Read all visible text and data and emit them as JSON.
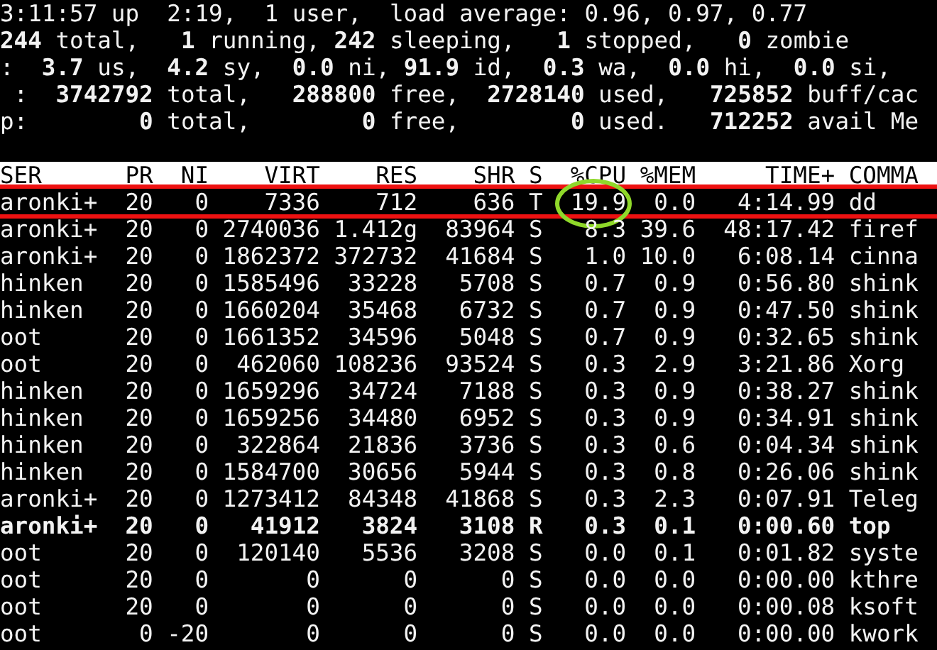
{
  "summary": [
    "3:11:57 up  2:19,  1 user,  load average: 0.96, 0.97, 0.77",
    "**244** total,   **1** running, **242** sleeping,   **1** stopped,   **0** zombie",
    ":  **3.7** us,  **4.2** sy,  **0.0** ni, **91.9** id,  **0.3** wa,  **0.0** hi,  **0.0** si,",
    " :  **3742792** total,   **288800** free,  **2728140** used,   **725852** buff/cac",
    "p:        **0** total,        **0** free,        **0** used.   **712252** avail Me"
  ],
  "columns": [
    "SER",
    "PR",
    "NI",
    "VIRT",
    "RES",
    "SHR",
    "S",
    "%CPU",
    "%MEM",
    "TIME+",
    "COMMA"
  ],
  "processes": [
    {
      "cells": [
        "aronki+",
        "20",
        "0",
        "7336",
        "712",
        "636",
        "T",
        "19.9",
        "0.0",
        "4:14.99",
        "dd"
      ],
      "bold": false,
      "highlighted": true,
      "circled": true
    },
    {
      "cells": [
        "aronki+",
        "20",
        "0",
        "2740036",
        "1.412g",
        "83964",
        "S",
        "8.3",
        "39.6",
        "48:17.42",
        "firef"
      ],
      "bold": false,
      "highlighted": false,
      "circled": false
    },
    {
      "cells": [
        "aronki+",
        "20",
        "0",
        "1862372",
        "372732",
        "41684",
        "S",
        "1.0",
        "10.0",
        "6:08.14",
        "cinna"
      ],
      "bold": false,
      "highlighted": false,
      "circled": false
    },
    {
      "cells": [
        "hinken",
        "20",
        "0",
        "1585496",
        "33228",
        "5708",
        "S",
        "0.7",
        "0.9",
        "0:56.80",
        "shink"
      ],
      "bold": false,
      "highlighted": false,
      "circled": false
    },
    {
      "cells": [
        "hinken",
        "20",
        "0",
        "1660204",
        "35468",
        "6732",
        "S",
        "0.7",
        "0.9",
        "0:47.50",
        "shink"
      ],
      "bold": false,
      "highlighted": false,
      "circled": false
    },
    {
      "cells": [
        "oot",
        "20",
        "0",
        "1661352",
        "34596",
        "5048",
        "S",
        "0.7",
        "0.9",
        "0:32.65",
        "shink"
      ],
      "bold": false,
      "highlighted": false,
      "circled": false
    },
    {
      "cells": [
        "oot",
        "20",
        "0",
        "462060",
        "108236",
        "93524",
        "S",
        "0.3",
        "2.9",
        "3:21.86",
        "Xorg"
      ],
      "bold": false,
      "highlighted": false,
      "circled": false
    },
    {
      "cells": [
        "hinken",
        "20",
        "0",
        "1659296",
        "34724",
        "7188",
        "S",
        "0.3",
        "0.9",
        "0:38.27",
        "shink"
      ],
      "bold": false,
      "highlighted": false,
      "circled": false
    },
    {
      "cells": [
        "hinken",
        "20",
        "0",
        "1659256",
        "34480",
        "6952",
        "S",
        "0.3",
        "0.9",
        "0:34.91",
        "shink"
      ],
      "bold": false,
      "highlighted": false,
      "circled": false
    },
    {
      "cells": [
        "hinken",
        "20",
        "0",
        "322864",
        "21836",
        "3736",
        "S",
        "0.3",
        "0.6",
        "0:04.34",
        "shink"
      ],
      "bold": false,
      "highlighted": false,
      "circled": false
    },
    {
      "cells": [
        "hinken",
        "20",
        "0",
        "1584700",
        "30656",
        "5944",
        "S",
        "0.3",
        "0.8",
        "0:26.06",
        "shink"
      ],
      "bold": false,
      "highlighted": false,
      "circled": false
    },
    {
      "cells": [
        "aronki+",
        "20",
        "0",
        "1273412",
        "84348",
        "41868",
        "S",
        "0.3",
        "2.3",
        "0:07.91",
        "Teleg"
      ],
      "bold": false,
      "highlighted": false,
      "circled": false
    },
    {
      "cells": [
        "aronki+",
        "20",
        "0",
        "41912",
        "3824",
        "3108",
        "R",
        "0.3",
        "0.1",
        "0:00.60",
        "top"
      ],
      "bold": true,
      "highlighted": false,
      "circled": false
    },
    {
      "cells": [
        "oot",
        "20",
        "0",
        "120140",
        "5536",
        "3208",
        "S",
        "0.0",
        "0.1",
        "0:01.82",
        "syste"
      ],
      "bold": false,
      "highlighted": false,
      "circled": false
    },
    {
      "cells": [
        "oot",
        "20",
        "0",
        "0",
        "0",
        "0",
        "S",
        "0.0",
        "0.0",
        "0:00.00",
        "kthre"
      ],
      "bold": false,
      "highlighted": false,
      "circled": false
    },
    {
      "cells": [
        "oot",
        "20",
        "0",
        "0",
        "0",
        "0",
        "S",
        "0.0",
        "0.0",
        "0:00.08",
        "ksoft"
      ],
      "bold": false,
      "highlighted": false,
      "circled": false
    },
    {
      "cells": [
        "oot",
        "0",
        "-20",
        "0",
        "0",
        "0",
        "S",
        "0.0",
        "0.0",
        "0:00.00",
        "kwork"
      ],
      "bold": false,
      "highlighted": false,
      "circled": false
    }
  ]
}
